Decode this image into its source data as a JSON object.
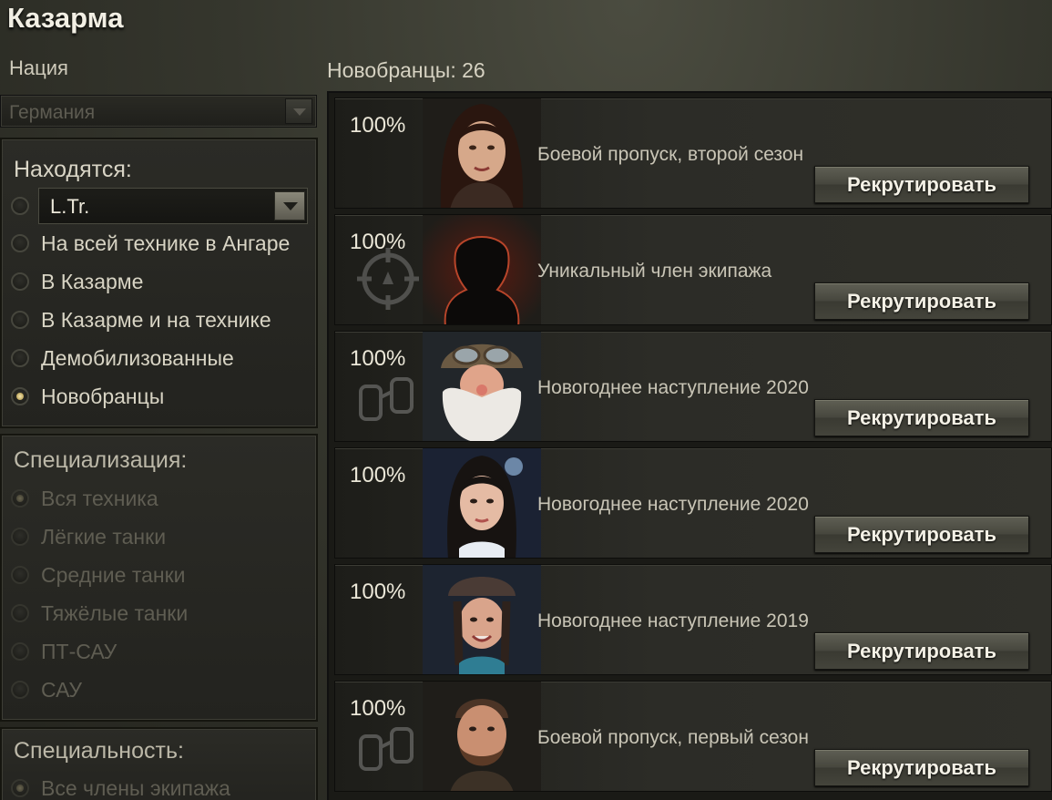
{
  "window": {
    "title": "Казарма"
  },
  "nation": {
    "label": "Нация",
    "selected": "Германия"
  },
  "location_filter": {
    "title": "Находятся:",
    "vehicle_selected": "L.Tr.",
    "options": [
      "На всей технике в Ангаре",
      "В Казарме",
      "В Казарме и на технике",
      "Демобилизованные",
      "Новобранцы"
    ],
    "selected_option": "Новобранцы"
  },
  "specialization_filter": {
    "title": "Специализация:",
    "options": [
      "Вся техника",
      "Лёгкие танки",
      "Средние танки",
      "Тяжёлые танки",
      "ПТ-САУ",
      "САУ"
    ],
    "selected_option": "Вся техника"
  },
  "specialty_filter": {
    "title": "Специальность:",
    "options": [
      "Все члены экипажа"
    ],
    "selected_option": "Все члены экипажа"
  },
  "recruits": {
    "count_label": "Новобранцы: 26",
    "items": [
      {
        "percent": "100%",
        "description": "Боевой пропуск, второй сезон",
        "button": "Рекрутировать",
        "icon": "woman-portrait"
      },
      {
        "percent": "100%",
        "description": "Уникальный член экипажа",
        "button": "Рекрутировать",
        "icon": "silhouette-portrait"
      },
      {
        "percent": "100%",
        "description": "Новогоднее наступление 2020",
        "button": "Рекрутировать",
        "icon": "santa-portrait"
      },
      {
        "percent": "100%",
        "description": "Новогоднее наступление 2020",
        "button": "Рекрутировать",
        "icon": "snow-maiden-portrait"
      },
      {
        "percent": "100%",
        "description": "Новогоднее наступление 2019",
        "button": "Рекрутировать",
        "icon": "winter-girl-portrait"
      },
      {
        "percent": "100%",
        "description": "Боевой пропуск, первый сезон",
        "button": "Рекрутировать",
        "icon": "bearded-man-portrait"
      }
    ]
  }
}
